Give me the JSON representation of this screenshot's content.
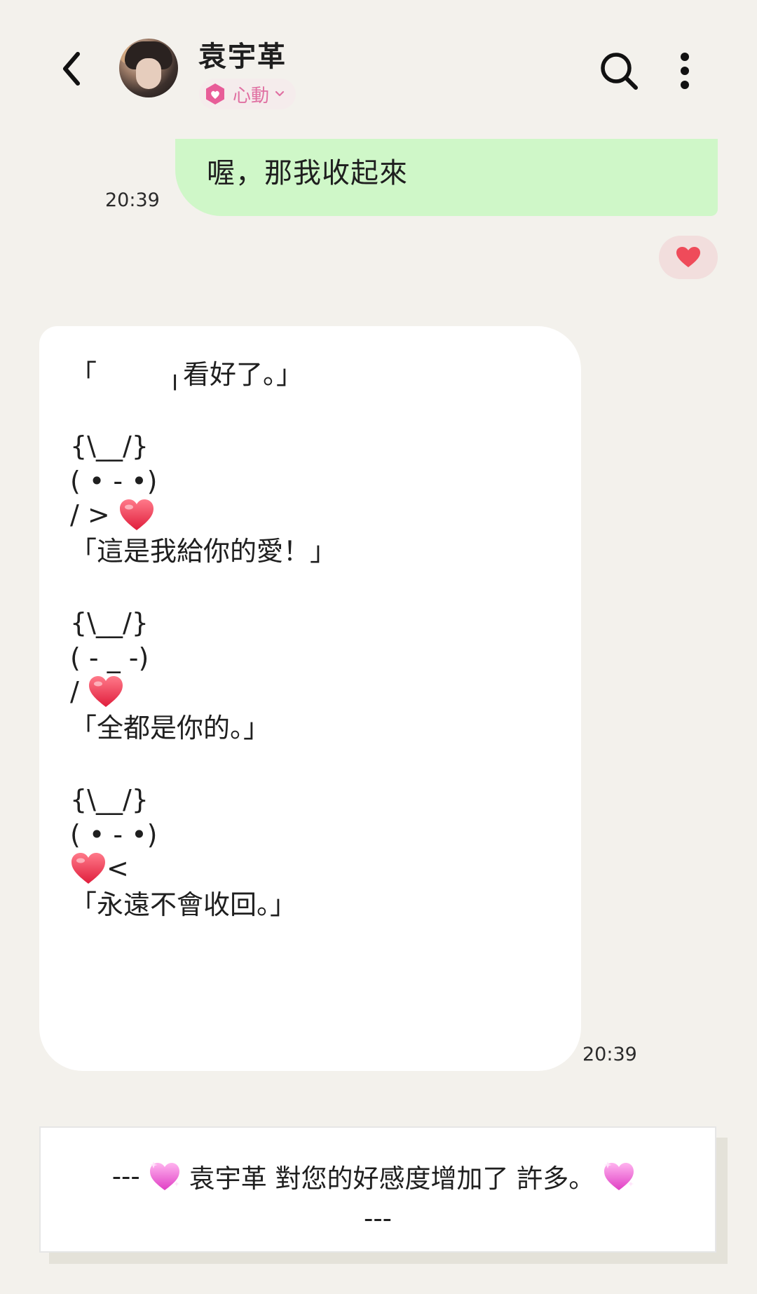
{
  "header": {
    "contact_name": "袁宇革",
    "mood_label": "心動",
    "back_icon": "chevron-left-icon",
    "search_icon": "search-icon",
    "more_icon": "more-vertical-icon"
  },
  "messages": {
    "sent": {
      "text": "喔，那我收起來",
      "time": "20:39",
      "reaction": "heart"
    },
    "received": {
      "lines": [
        "「　　  ╷看好了。」",
        "{\\__/}",
        "( • - •)",
        "/ > ",
        "「這是我給你的愛！」",
        "{\\__/}",
        "( - _ -)",
        "/ ",
        "「全都是你的。」",
        "{\\__/}",
        "( • - •)",
        "<",
        "「永遠不會收回。」"
      ],
      "time": "20:39"
    }
  },
  "notice": {
    "prefix": "---",
    "text": "袁宇革 對您的好感度增加了 許多。",
    "suffix": "---"
  },
  "colors": {
    "background": "#f3f1ec",
    "sent_bubble": "#cff7c8",
    "received_bubble": "#ffffff",
    "mood_accent": "#e070a2",
    "heart": "#ef4b5a"
  }
}
